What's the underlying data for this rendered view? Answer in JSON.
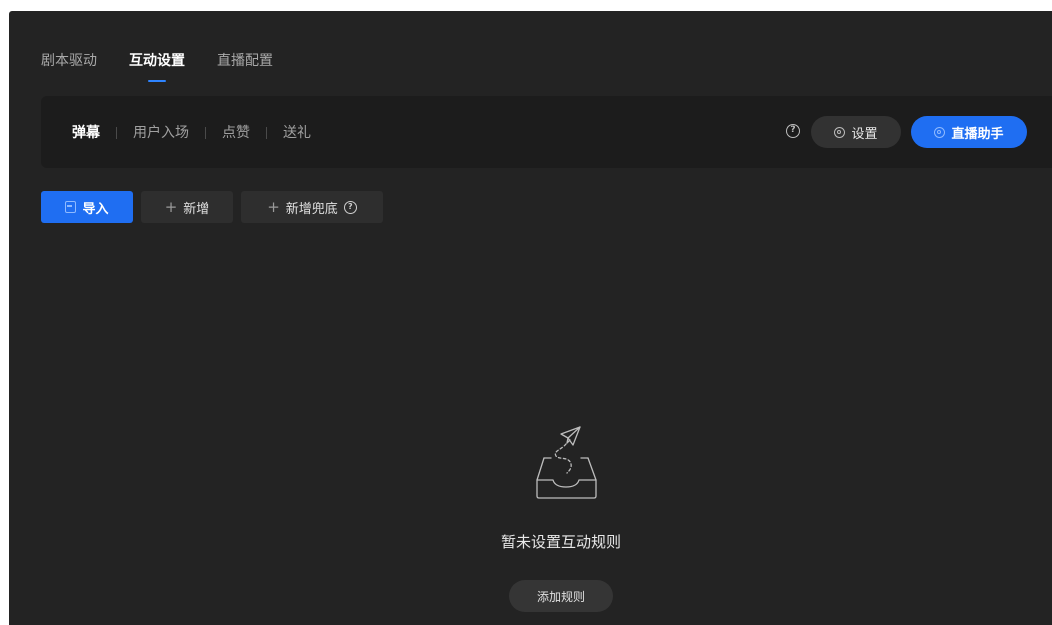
{
  "top_tabs": [
    {
      "label": "剧本驱动"
    },
    {
      "label": "互动设置",
      "active": true
    },
    {
      "label": "直播配置"
    }
  ],
  "sub_tabs": [
    {
      "label": "弹幕",
      "active": true
    },
    {
      "label": "用户入场"
    },
    {
      "label": "点赞"
    },
    {
      "label": "送礼"
    }
  ],
  "toolbar": {
    "help_glyph": "?",
    "settings_label": "设置",
    "live_assistant_label": "直播助手"
  },
  "actions": {
    "import_label": "导入",
    "add_label": "新增",
    "add_fallback_label": "新增兜底",
    "plus_glyph": "+",
    "help_glyph": "?"
  },
  "empty_state": {
    "message": "暂未设置互动规则",
    "add_rule_label": "添加规则"
  },
  "colors": {
    "background": "#232323",
    "panel": "#1c1c1c",
    "accent": "#1f6ef2",
    "tab_indicator": "#2e84ff"
  },
  "icons": {
    "help": "help-circle-icon",
    "settings": "gear-icon",
    "import": "import-icon",
    "add": "plus-icon",
    "empty": "empty-inbox-icon"
  }
}
